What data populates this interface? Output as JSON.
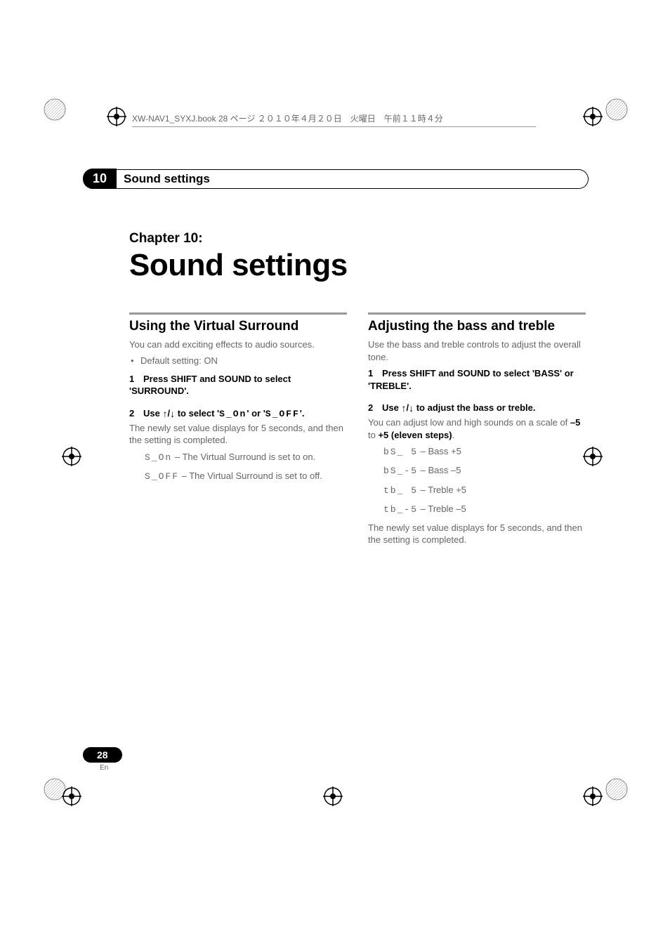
{
  "book_header": "XW-NAV1_SYXJ.book  28 ページ  ２０１０年４月２０日　火曜日　午前１１時４分",
  "chapter_num": "10",
  "chapter_bar_title": "Sound settings",
  "chapter_label": "Chapter 10:",
  "main_title": "Sound settings",
  "left": {
    "section_title": "Using the Virtual Surround",
    "intro": "You can add exciting effects to audio sources.",
    "bullet": "Default setting: ON",
    "step1": "Press SHIFT and SOUND to select 'SURROUND'.",
    "step2_prefix": "Use ",
    "step2_mid": " to select '",
    "step2_seg1": "S_On",
    "step2_or": "' or '",
    "step2_seg2": "S_OFF",
    "step2_end": "'.",
    "step2_body": "The newly set value displays for 5 seconds, and then the setting is completed.",
    "opt1_seg": "S_On",
    "opt1_desc": " – The Virtual Surround is set to on.",
    "opt2_seg": "S_OFF",
    "opt2_desc": " – The Virtual Surround is set to off."
  },
  "right": {
    "section_title": "Adjusting the bass and treble",
    "intro": "Use the bass and treble controls to adjust the overall tone.",
    "step1": "Press SHIFT and SOUND to select 'BASS' or 'TREBLE'.",
    "step2_prefix": "Use ",
    "step2_suffix": " to adjust the bass or treble.",
    "step2_body_pre": "You can adjust low and high sounds on a scale of ",
    "range_low": "–5",
    "range_to": " to ",
    "range_high": "+5 (eleven steps)",
    "range_period": ".",
    "r1_seg": "bS_ 5",
    "r1_desc": " – Bass +5",
    "r2_seg": "bS_-5",
    "r2_desc": " – Bass –5",
    "r3_seg": "tb_ 5",
    "r3_desc": " – Treble +5",
    "r4_seg": "tb_-5",
    "r4_desc": " – Treble –5",
    "closing": "The newly set value displays for 5 seconds, and then the setting is completed."
  },
  "page_num": "28",
  "page_lang": "En"
}
